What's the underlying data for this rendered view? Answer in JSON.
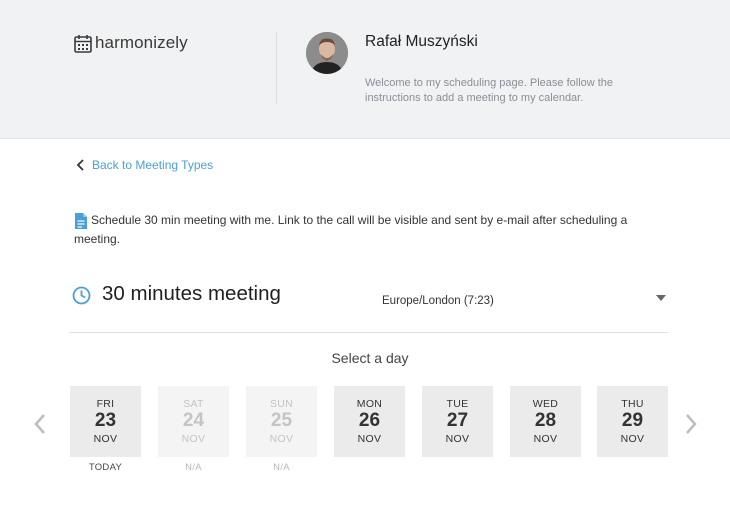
{
  "header": {
    "brand": "harmonizely",
    "host_name": "Rafał Muszyński",
    "welcome": "Welcome to my scheduling page. Please follow the instructions to add a meeting to my calendar.",
    "icons": {
      "logo": "calendar-icon",
      "avatar": "user-photo"
    }
  },
  "back_link": {
    "label": "Back to Meeting Types",
    "icon": "chevron-left-icon"
  },
  "description": {
    "text": "Schedule 30 min meeting with me. Link to the call will be visible and sent by e-mail after scheduling a meeting.",
    "icon": "document-icon"
  },
  "meeting": {
    "title": "30 minutes meeting",
    "timezone": "Europe/London (7:23)",
    "icon": "clock-icon"
  },
  "calendar": {
    "heading": "Select a day",
    "days": [
      {
        "dow": "FRI",
        "date": "23",
        "month": "NOV",
        "sub": "TODAY",
        "available": true
      },
      {
        "dow": "SAT",
        "date": "24",
        "month": "NOV",
        "sub": "N/A",
        "available": false
      },
      {
        "dow": "SUN",
        "date": "25",
        "month": "NOV",
        "sub": "N/A",
        "available": false
      },
      {
        "dow": "MON",
        "date": "26",
        "month": "NOV",
        "sub": "",
        "available": true
      },
      {
        "dow": "TUE",
        "date": "27",
        "month": "NOV",
        "sub": "",
        "available": true
      },
      {
        "dow": "WED",
        "date": "28",
        "month": "NOV",
        "sub": "",
        "available": true
      },
      {
        "dow": "THU",
        "date": "29",
        "month": "NOV",
        "sub": "",
        "available": true
      }
    ]
  },
  "colors": {
    "accent": "#4a9fd6",
    "header_bg": "#f1f2f4",
    "day_bg": "#ebebeb",
    "day_disabled_bg": "#f4f4f4"
  }
}
